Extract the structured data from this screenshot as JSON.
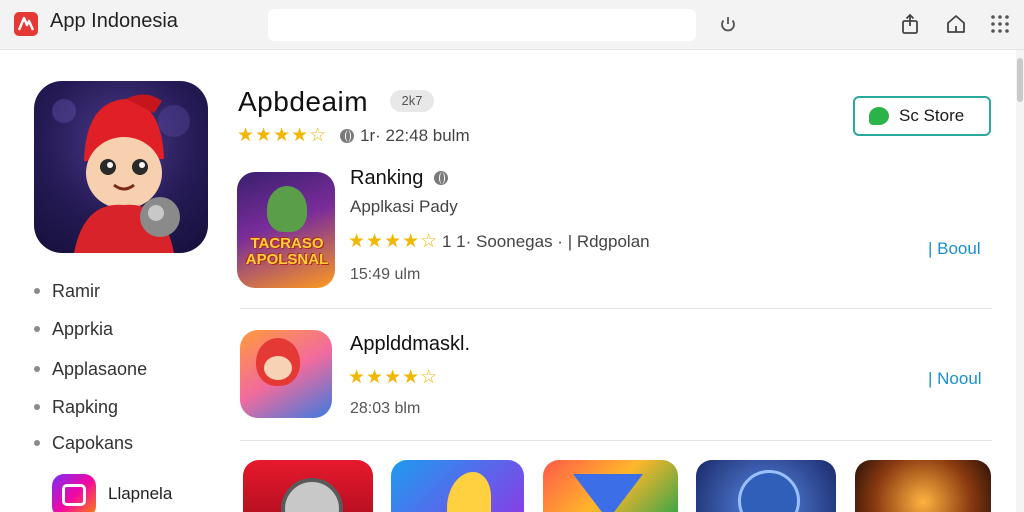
{
  "topbar": {
    "title": "App Indonesia",
    "search_placeholder": "",
    "icons": [
      "power-icon",
      "share-icon",
      "home-icon",
      "grid-menu-icon"
    ]
  },
  "sidebar": {
    "items": [
      {
        "label": "Ramir"
      },
      {
        "label": "Apprkia"
      },
      {
        "label": "Applasaone"
      },
      {
        "label": "Rapking"
      },
      {
        "label": "Capokans"
      }
    ],
    "featured": {
      "label": "Llapnela"
    }
  },
  "header_app": {
    "title": "Apbdeaim",
    "badge": "2k7",
    "rating_stars": "★★★★☆",
    "meta": "1r· 22:48 bulm",
    "store_button": "Sc Store"
  },
  "list": [
    {
      "title": "Ranking",
      "subtitle": "Applkasi Pady",
      "rating_stars": "★★★★☆",
      "meta": "1 1· Soonegas · | Rdgpolan",
      "size": "15:49 ulm",
      "action": "| Booul",
      "icon_text": "TACRASO APOLSNAL"
    },
    {
      "title": "Applddmaskl.",
      "rating_stars": "★★★★☆",
      "size": "28:03 blm",
      "action": "| Nooul"
    }
  ],
  "colors": {
    "accent": "#1a8fd0",
    "star": "#f2b705",
    "store_border": "#2aa89a",
    "logo": "#e53935"
  }
}
